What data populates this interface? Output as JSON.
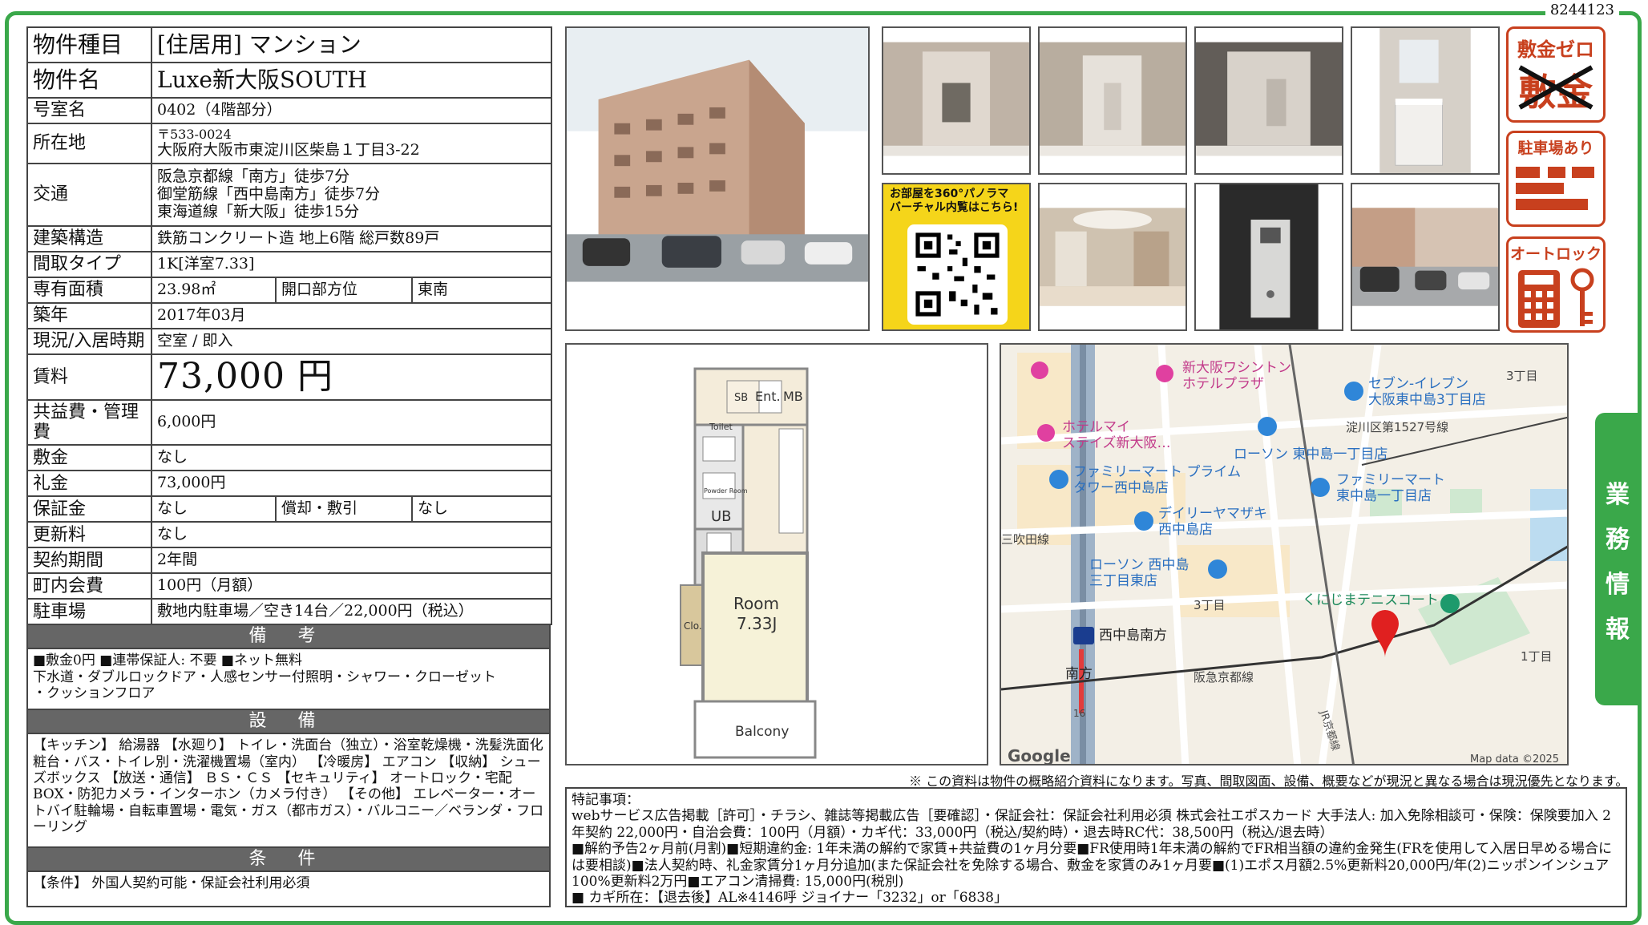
{
  "property_id": "8244123",
  "specs": {
    "type_label": "物件種目",
    "type_value": "[住居用] マンション",
    "name_label": "物件名",
    "name_value": "Luxe新大阪SOUTH",
    "room_label": "号室名",
    "room_value": "0402（4階部分）",
    "address_label": "所在地",
    "address_zip": "〒533-0024",
    "address_value": "大阪府大阪市東淀川区柴島１丁目3-22",
    "access_label": "交通",
    "access_1": "阪急京都線「南方」徒歩7分",
    "access_2": "御堂筋線「西中島南方」徒歩7分",
    "access_3": "東海道線「新大阪」徒歩15分",
    "structure_label": "建築構造",
    "structure_value": "鉄筋コンクリート造 地上6階 総戸数89戸",
    "layout_label": "間取タイプ",
    "layout_value": "1K[洋室7.33]",
    "area_label": "専有面積",
    "area_value": "23.98㎡",
    "direction_label": "開口部方位",
    "direction_value": "東南",
    "built_label": "築年",
    "built_value": "2017年03月",
    "status_label": "現況/入居時期",
    "status_value": "空室 / 即入",
    "rent_label": "賃料",
    "rent_value": "73,000 円",
    "fee_label": "共益費・管理費",
    "fee_value": "6,000円",
    "deposit_label": "敷金",
    "deposit_value": "なし",
    "keymoney_label": "礼金",
    "keymoney_value": "73,000円",
    "guarantee_label": "保証金",
    "guarantee_value": "なし",
    "amort_label": "償却・敷引",
    "amort_value": "なし",
    "renewal_label": "更新料",
    "renewal_value": "なし",
    "contract_label": "契約期間",
    "contract_value": "2年間",
    "town_label": "町内会費",
    "town_value": "100円（月額）",
    "parking_label": "駐車場",
    "parking_value": "敷地内駐車場／空き14台／22,000円（税込）"
  },
  "bikou": {
    "title": "備 考",
    "line1": "■敷金0円 ■連帯保証人: 不要 ■ネット無料",
    "line2": "下水道・ダブルロックドア・人感センサー付照明・シャワー・クローゼット",
    "line3": "・クッションフロア"
  },
  "setsubi": {
    "title": "設 備",
    "text": "【キッチン】 給湯器 【水廻り】 トイレ・洗面台（独立）・浴室乾燥機・洗髪洗面化粧台・バス・トイレ別・洗濯機置場（室内） 【冷暖房】 エアコン 【収納】 シューズボックス 【放送・通信】 ＢＳ・ＣＳ 【セキュリティ】 オートロック・宅配BOX・防犯カメラ・インターホン（カメラ付き） 【その他】 エレベーター・オートバイ駐輪場・自転車置場・電気・ガス（都市ガス）・バルコニー／ベランダ・フローリング"
  },
  "jouken": {
    "title": "条 件",
    "text": "【条件】 外国人契約可能・保証会社利用必須"
  },
  "qr": {
    "line1": "お部屋を360°パノラマ",
    "line2": "バーチャル内覧はこちら!"
  },
  "badges": {
    "shikikin_top": "敷金ゼロ",
    "shikikin_crossed": "敷金",
    "parking": "駐車場あり",
    "autolock": "オートロック"
  },
  "side_tab": [
    "業",
    "務",
    "情",
    "報"
  ],
  "floorplan": {
    "sb": "SB",
    "ent": "Ent.",
    "mb": "MB",
    "toilet": "Toilet",
    "powder": "Powder Room",
    "ub": "UB",
    "clo": "Clo.",
    "room": "Room",
    "room_size": "7.33J",
    "balcony": "Balcony"
  },
  "map": {
    "labels": {
      "hotel1_a": "新大阪ワシントン",
      "hotel1_b": "ホテルプラザ",
      "hotel2_a": "ホテルマイ",
      "hotel2_b": "ステイズ新大阪…",
      "seven_a": "セブン-イレブン",
      "seven_b": "大阪東中島3丁目店",
      "yodogawa": "淀川区第1527号線",
      "lawson1": "ローソン 東中島一丁目店",
      "fm1_a": "ファミリーマート プライム",
      "fm1_b": "タワー西中島店",
      "fm2_a": "ファミリーマート",
      "fm2_b": "東中島一丁目店",
      "daily_a": "デイリーヤマザキ",
      "daily_b": "西中島店",
      "sanbonmatsu": "三吹田線",
      "lawson2_a": "ローソン 西中島",
      "lawson2_b": "三丁目東店",
      "chome3_top": "3丁目",
      "chome3_mid": "3丁目",
      "chome1": "1丁目",
      "tennis": "くにじまテニスコート",
      "station": "西中島南方",
      "minamikata": "南方",
      "hankyu": "阪急京都線",
      "jr": "JR京都線",
      "route16": "16",
      "google": "Google",
      "mapdata": "Map data ©2025"
    }
  },
  "disclaimer": "※ この資料は物件の概略紹介資料になります。写真、間取図面、設備、概要などが現況と異なる場合は現況優先となります。",
  "remarks": {
    "title": "特記事項：",
    "line1": "webサービス広告掲載［許可］・チラシ、雑誌等掲載広告［要確認］・保証会社：保証会社利用必須 株式会社エポスカード 大手法人: 加入免除相談可・保険：保険要加入 2年契約 22,000円・自治会費：100円（月額）・カギ代：33,000円（税込/契約時）・退去時RC代：38,500円（税込/退去時）",
    "line2": "■解約予告2ヶ月前(月割)■短期違約金: 1年未満の解約で家賃+共益費の1ヶ月分要■FR使用時1年未満の解約でFR相当額の違約金発生(FRを使用して入居日早める場合には要相談)■法人契約時、礼金家賃分1ヶ月分追加(また保証会社を免除する場合、敷金を家賃のみ1ヶ月要■(1)エポス月額2.5%更新料20,000円/年(2)ニッポンインシュア100%更新料2万円■エアコン清掃費: 15,000円(税別)",
    "line3": "■ カギ所在：【退去後】AL※4146呼 ジョイナー「3232」or「6838」"
  }
}
